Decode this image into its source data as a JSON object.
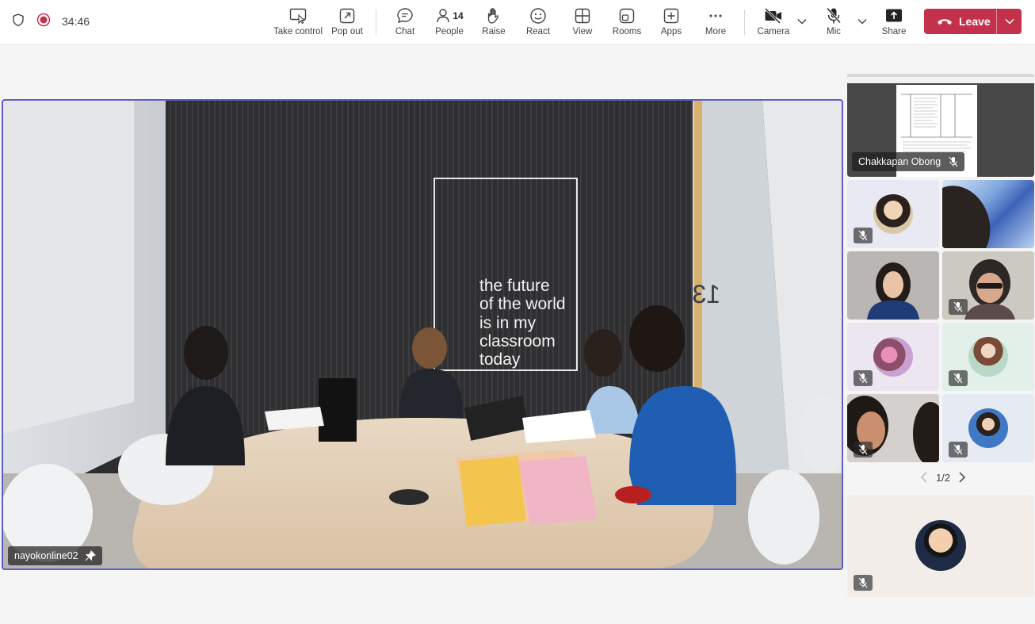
{
  "status": {
    "timer": "34:46"
  },
  "toolbar": {
    "take_control": "Take control",
    "pop_out": "Pop out",
    "chat": "Chat",
    "people": "People",
    "people_count": "14",
    "raise": "Raise",
    "react": "React",
    "view": "View",
    "rooms": "Rooms",
    "apps": "Apps",
    "more": "More",
    "camera": "Camera",
    "mic": "Mic",
    "share": "Share",
    "leave": "Leave"
  },
  "stage": {
    "participant_name": "nayokonline02",
    "wall_text": [
      "the future",
      "of the world",
      "is in my",
      "classroom",
      "today"
    ],
    "wall_number": "13"
  },
  "gallery": {
    "shared_screen_name": "Chakkapan Obong",
    "page_indicator": "1/2"
  },
  "colors": {
    "accent": "#5b5fc7",
    "leave": "#c4314b",
    "recording": "#c4314b"
  }
}
